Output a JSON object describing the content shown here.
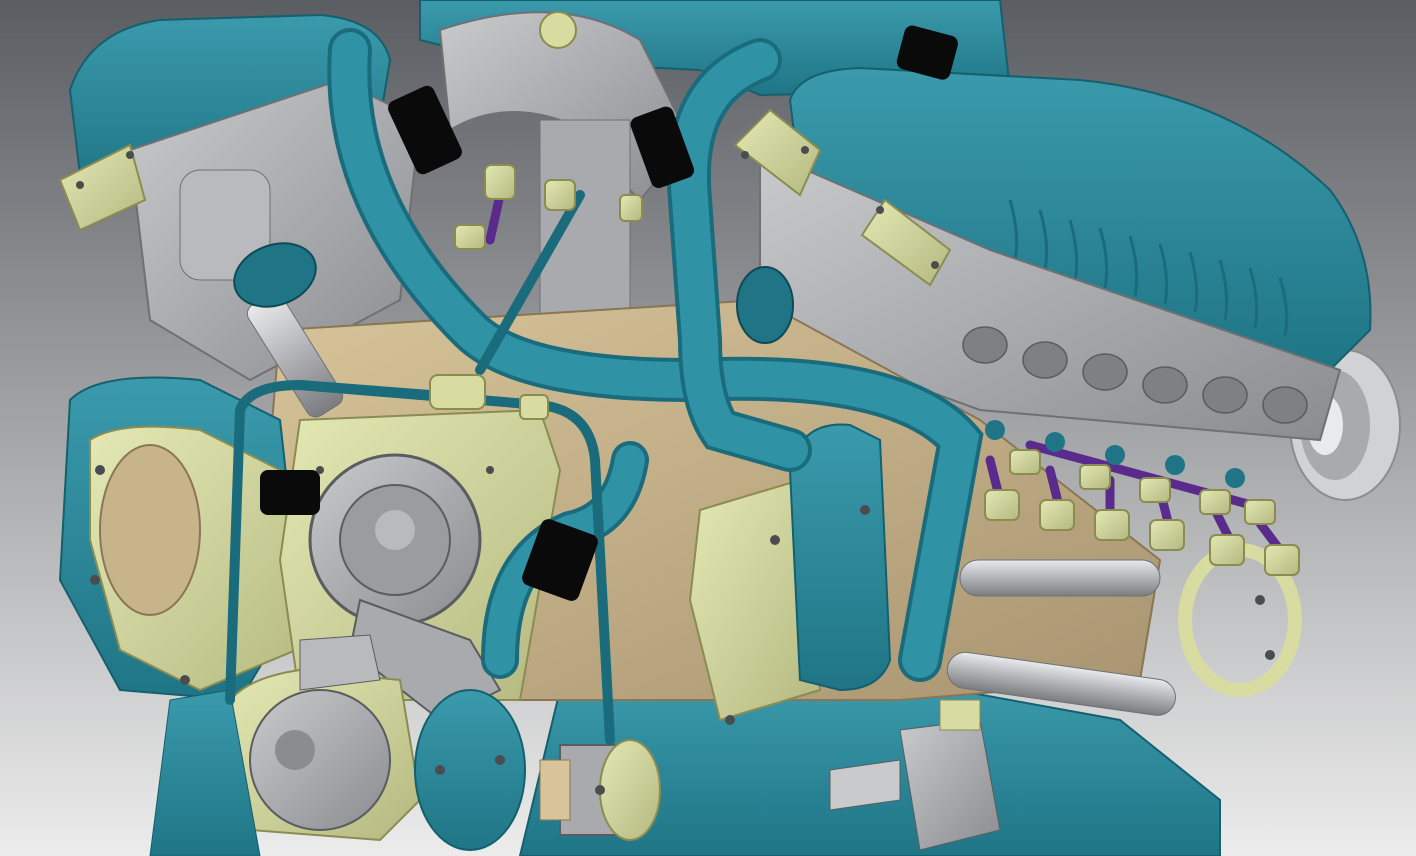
{
  "scene": {
    "subject": "engine-cad-model",
    "colors": {
      "bg_top": "#5a5d62",
      "bg_bottom": "#ececec",
      "teal": "#2a8a9c",
      "teal_dark": "#1a6b7c",
      "teal_light": "#4aa8b8",
      "khaki": "#d8dca0",
      "khaki_dark": "#a8aa70",
      "tan": "#c8b48a",
      "tan_dark": "#9a8664",
      "grey": "#a4a6aa",
      "grey_light": "#c8cacc",
      "grey_dark": "#6e7074",
      "black": "#0a0a0a",
      "purple": "#5a2a8c",
      "hose": "#2a8a9c"
    },
    "icons": [
      "bolt-icon",
      "hose-clamp-icon",
      "fitting-icon"
    ]
  }
}
